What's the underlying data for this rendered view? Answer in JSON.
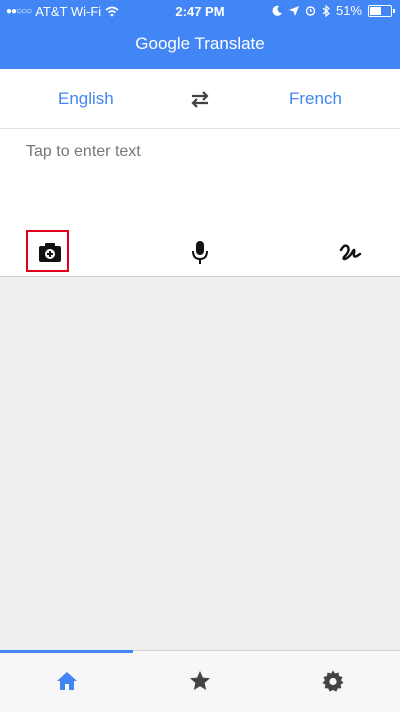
{
  "status_bar": {
    "carrier": "AT&T Wi-Fi",
    "time": "2:47 PM",
    "battery": "51%",
    "battery_level": 0.51
  },
  "app": {
    "title": "Google Translate"
  },
  "languages": {
    "source": "English",
    "target": "French"
  },
  "input": {
    "placeholder": "Tap to enter text"
  },
  "tools": [
    "camera-icon",
    "microphone-icon",
    "handwriting-icon"
  ],
  "bottom_nav": {
    "items": [
      "home-icon",
      "star-icon",
      "settings-icon"
    ],
    "active_index": 0
  },
  "colors": {
    "brand_blue": "#4285f4",
    "highlight_red": "#e0001b",
    "background": "#eeeeee"
  }
}
